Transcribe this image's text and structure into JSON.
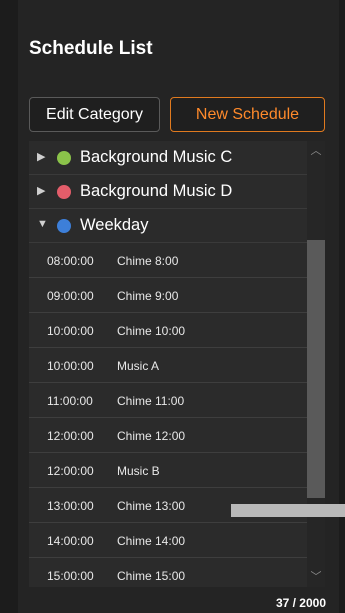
{
  "header": {
    "title": "Schedule List"
  },
  "toolbar": {
    "edit_category": "Edit Category",
    "new_schedule": "New Schedule"
  },
  "categories": [
    {
      "label": "Background Music C",
      "color": "#8bc34a",
      "expanded": false,
      "arrow": "▶"
    },
    {
      "label": "Background Music D",
      "color": "#e35d6a",
      "expanded": false,
      "arrow": "▶"
    },
    {
      "label": "Weekday",
      "color": "#3d7fd9",
      "expanded": true,
      "arrow": "▼"
    }
  ],
  "schedules": [
    {
      "time": "08:00:00",
      "name": "Chime 8:00"
    },
    {
      "time": "09:00:00",
      "name": "Chime 9:00"
    },
    {
      "time": "10:00:00",
      "name": "Chime 10:00"
    },
    {
      "time": "10:00:00",
      "name": "Music A"
    },
    {
      "time": "11:00:00",
      "name": "Chime 11:00"
    },
    {
      "time": "12:00:00",
      "name": "Chime 12:00"
    },
    {
      "time": "12:00:00",
      "name": "Music B"
    },
    {
      "time": "13:00:00",
      "name": "Chime 13:00"
    },
    {
      "time": "14:00:00",
      "name": "Chime 14:00"
    },
    {
      "time": "15:00:00",
      "name": "Chime 15:00"
    }
  ],
  "footer": {
    "counter": "37 / 2000"
  },
  "icons": {
    "scroll_up": "chevron-up-icon",
    "scroll_down": "chevron-down-icon"
  }
}
